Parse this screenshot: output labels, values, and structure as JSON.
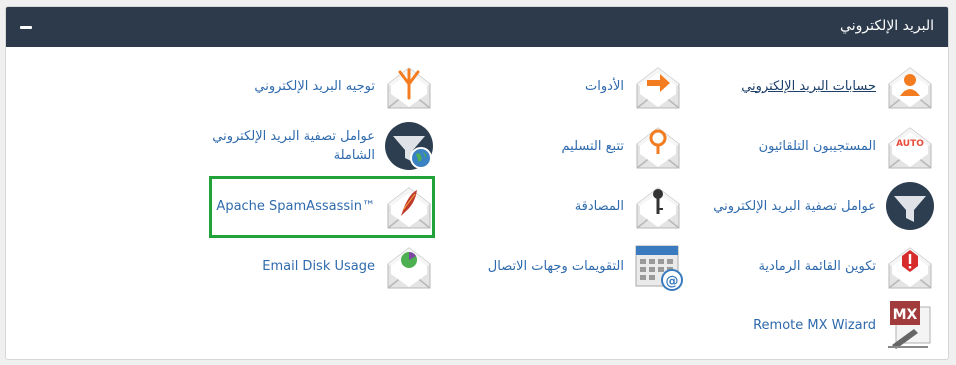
{
  "panel": {
    "title": "البريد الإلكتروني",
    "collapse_icon": "minus-icon"
  },
  "colors": {
    "header_bg": "#2d3a4b",
    "link": "#2f6aad",
    "highlight_border": "#22a33a",
    "accent_orange": "#f47c20"
  },
  "items": {
    "email_accounts": {
      "label": "حسابات البريد الإلكتروني",
      "icon": "envelope-user-icon"
    },
    "tools": {
      "label": "الأدوات",
      "icon": "envelope-arrow-icon"
    },
    "forwarders": {
      "label": "توجيه البريد الإلكتروني",
      "icon": "envelope-fork-icon"
    },
    "autoresponders": {
      "label": "المستجيبون التلقائيون",
      "icon": "envelope-auto-icon",
      "badge": "AUTO"
    },
    "track_delivery": {
      "label": "تتبع التسليم",
      "icon": "envelope-pin-icon"
    },
    "global_filters": {
      "label": "عوامل تصفية البريد الإلكتروني الشاملة",
      "icon": "funnel-globe-icon"
    },
    "email_filters": {
      "label": "عوامل تصفية البريد الإلكتروني",
      "icon": "funnel-icon"
    },
    "authentication": {
      "label": "المصادقة",
      "icon": "envelope-key-icon"
    },
    "spamassassin": {
      "label": "Apache SpamAssassin™",
      "icon": "envelope-feather-icon"
    },
    "greylisting": {
      "label": "تكوين القائمة الرمادية",
      "icon": "envelope-alert-icon"
    },
    "calendars": {
      "label": "التقويمات وجهات الاتصال",
      "icon": "calendar-at-icon"
    },
    "disk_usage": {
      "label": "Email Disk Usage",
      "icon": "envelope-pie-icon"
    },
    "remote_mx": {
      "label": "Remote MX Wizard",
      "icon": "mx-wizard-icon",
      "badge": "MX"
    }
  }
}
